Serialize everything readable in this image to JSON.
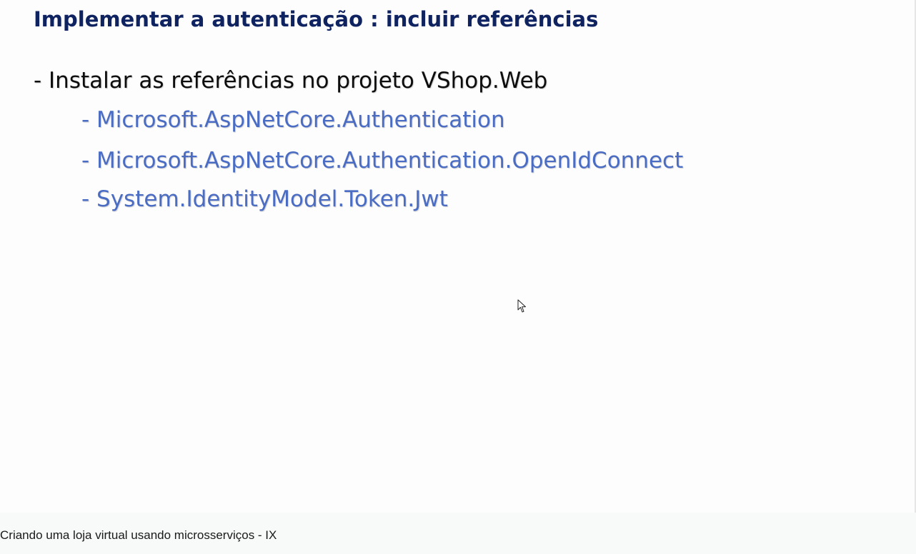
{
  "slide": {
    "title": "Implementar a autenticação :  incluir referências",
    "main_bullet": "- Instalar as referências no projeto VShop.Web",
    "sub_bullets": [
      "- Microsoft.AspNetCore.Authentication",
      "- Microsoft.AspNetCore.Authentication.OpenIdConnect",
      "- System.IdentityModel.Token.Jwt"
    ],
    "colors": {
      "title": "#0f2361",
      "main_text": "#0d0d0d",
      "sub_text": "#4a6cc3"
    }
  },
  "cursor": {
    "icon": "mouse-pointer-icon"
  },
  "caption": {
    "text": "Criando uma loja virtual usando microsserviços - IX"
  }
}
